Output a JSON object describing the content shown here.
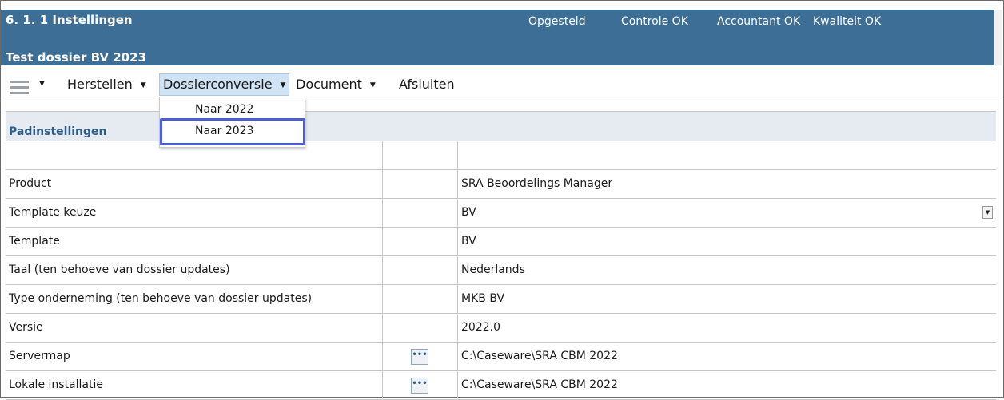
{
  "header": {
    "title": "6. 1.  1 Instellingen",
    "subtitle": "Test dossier BV 2023",
    "status_items": [
      "Opgesteld",
      "Controle OK",
      "Accountant OK",
      "Kwaliteit OK"
    ]
  },
  "menubar": {
    "items": [
      {
        "label": "Herstellen"
      },
      {
        "label": "Dossierconversie"
      },
      {
        "label": "Document"
      },
      {
        "label": "Afsluiten"
      }
    ]
  },
  "dropdown": {
    "options": [
      "Naar 2022",
      "Naar 2023"
    ],
    "highlighted": "Naar 2023"
  },
  "table": {
    "section_title": "Padinstellingen",
    "rows": [
      {
        "label": "Product",
        "value": "SRA Beoordelings Manager"
      },
      {
        "label": "Template keuze",
        "value": "BV"
      },
      {
        "label": "Template",
        "value": "BV"
      },
      {
        "label": "Taal (ten behoeve van dossier updates)",
        "value": "Nederlands"
      },
      {
        "label": "Type onderneming (ten behoeve van dossier updates)",
        "value": "MKB BV"
      },
      {
        "label": "Versie",
        "value": "2022.0"
      },
      {
        "label": "Servermap",
        "value": "C:\\Caseware\\SRA CBM 2022"
      },
      {
        "label": "Lokale installatie",
        "value": "C:\\Caseware\\SRA CBM 2022"
      }
    ]
  },
  "icons": {
    "menu": "hamburger-icon",
    "caret": "caret-down-icon",
    "browse": "ellipsis-icon",
    "select": "select-arrow-icon"
  },
  "colors": {
    "header_bg": "#3d6f96",
    "active_menu_bg": "#cfe3f5",
    "highlight_border": "#4b5ed8",
    "section_text": "#2e5b86"
  }
}
